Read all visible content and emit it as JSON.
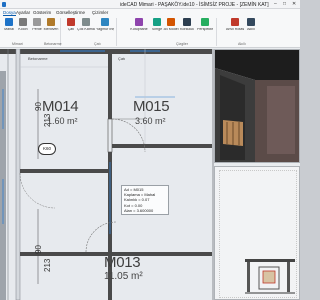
{
  "window": {
    "title": "ideCAD Mimari - PAŞAKÖY.ide10 - İSİMSİZ PROJE - [ZEMİN KAT]",
    "controls": [
      "–",
      "□",
      "✕"
    ]
  },
  "menu": {
    "tabs": [
      "Dosya",
      "Ayarlar",
      "Gösterim",
      "Görselleştirme",
      "Çizimler"
    ],
    "active_index": 0
  },
  "ribbon": {
    "buttons": [
      {
        "label": "Mahal",
        "color": "#1e73c8"
      },
      {
        "label": "Kolon",
        "color": "#7a7a7a"
      },
      {
        "label": "Perde",
        "color": "#9a9a9a"
      },
      {
        "label": "Merdiven",
        "color": "#b07a2a"
      },
      {
        "label": "Çatı",
        "color": "#c0392b"
      },
      {
        "label": "Çok Katmanlı",
        "color": "#7f8c8d"
      },
      {
        "label": "Yağmur İniş Borusu",
        "color": "#2e86c1"
      },
      {
        "label": "Kütüphane",
        "color": "#8e44ad"
      },
      {
        "label": "Simge",
        "color": "#16a085"
      },
      {
        "label": "3B Model",
        "color": "#d35400"
      },
      {
        "label": "Korkuluk",
        "color": "#2c3e50"
      },
      {
        "label": "Perspektif",
        "color": "#27ae60"
      },
      {
        "label": "Anvil Rotasyonu",
        "color": "#c0392b"
      },
      {
        "label": "Akıllı",
        "color": "#34495e"
      }
    ],
    "groups": [
      "Mimari",
      "Betonarme",
      "Çatı",
      "Çizgiler",
      "Akıllı"
    ]
  },
  "canvas": {
    "rooms": [
      {
        "name": "M014",
        "area": "1.60 m²"
      },
      {
        "name": "M015",
        "area": "3.60 m²"
      },
      {
        "name": "M013",
        "area": "11.05 m²"
      }
    ],
    "dimensions": [
      "90",
      "213",
      "90",
      "213"
    ],
    "level_marker": "K60",
    "tooltip": {
      "lines": [
        "Ad = M015",
        "Kaplama = Mahal",
        "Kalınlık = 0.07",
        "Kot = 0.00",
        "Alan = 3.600000"
      ]
    }
  },
  "colors": {
    "wall": "#4a4a4a",
    "window": "#2f7fd1",
    "door_arc": "#777777",
    "canvas_bg": "#e7eaee",
    "accent": "#0b5cad"
  }
}
